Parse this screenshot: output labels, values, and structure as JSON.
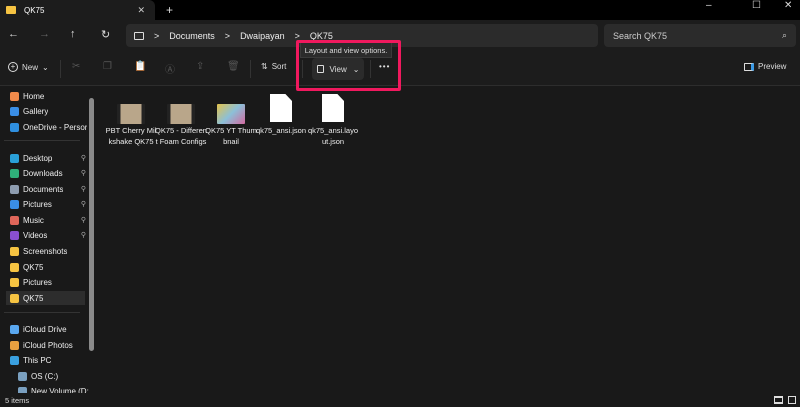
{
  "tab": {
    "title": "QK75",
    "close": "✕",
    "new": "+"
  },
  "window": {
    "minimize": "–",
    "maximize": "☐",
    "close": "✕"
  },
  "nav": {
    "back": "←",
    "forward": "→",
    "up": "↑",
    "refresh": "↻"
  },
  "breadcrumb": {
    "sep": ">",
    "items": [
      "Documents",
      "Dwaipayan",
      "QK75"
    ]
  },
  "search": {
    "placeholder": "Search QK75",
    "icon": "⌕"
  },
  "toolbar": {
    "new": "New",
    "sort": "Sort",
    "view": "View",
    "more": "•••",
    "preview": "Preview",
    "tooltip": "Layout and view options."
  },
  "sidebar": {
    "items": [
      {
        "label": "Home",
        "color": "#f08a4b"
      },
      {
        "label": "Gallery",
        "color": "#3a8ee6"
      },
      {
        "label": "OneDrive - Persor",
        "color": "#2f8fdf"
      },
      {
        "label": "Desktop",
        "color": "#2aa0d8"
      },
      {
        "label": "Downloads",
        "color": "#2fb07a"
      },
      {
        "label": "Documents",
        "color": "#8e9db0"
      },
      {
        "label": "Pictures",
        "color": "#3a8ee6"
      },
      {
        "label": "Music",
        "color": "#e0665a"
      },
      {
        "label": "Videos",
        "color": "#8a4fd0"
      },
      {
        "label": "Screenshots",
        "color": "#f5c342"
      },
      {
        "label": "QK75",
        "color": "#f5c342"
      },
      {
        "label": "Pictures",
        "color": "#f5c342"
      },
      {
        "label": "QK75",
        "color": "#f5c342"
      },
      {
        "label": "iCloud Drive",
        "color": "#5aa8f0"
      },
      {
        "label": "iCloud Photos",
        "color": "#e8a040"
      },
      {
        "label": "This PC",
        "color": "#3aa0e0"
      },
      {
        "label": "OS (C:)",
        "color": "#7aa0c0"
      },
      {
        "label": "New Volume (D:",
        "color": "#7aa0c0"
      }
    ],
    "pin": "📌"
  },
  "files": [
    {
      "name": "PBT Cherry Milkshake QK75",
      "type": "video"
    },
    {
      "name": "QK75 - Different Foam Configs",
      "type": "video"
    },
    {
      "name": "QK75 YT Thumbnail",
      "type": "image"
    },
    {
      "name": "qk75_ansi.json",
      "type": "file"
    },
    {
      "name": "qk75_ansi.layout.json",
      "type": "file"
    }
  ],
  "status": {
    "count": "5 items"
  }
}
